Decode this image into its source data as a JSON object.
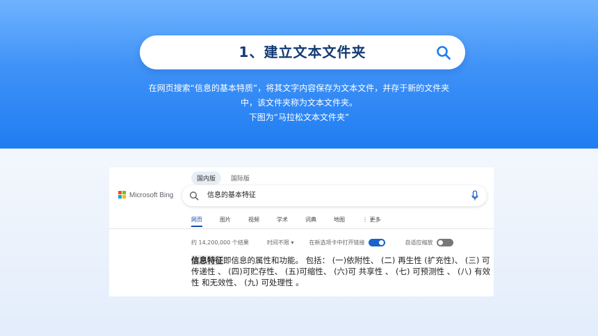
{
  "slide": {
    "title": "1、建立文本文件夹",
    "description": [
      "在网页搜索“信息的基本特质”，将其文字内容保存为文本文件，并存于新的文件夹",
      "中，该文件夹称为文本文件夹。",
      "下图为“马拉松文本文件夹”"
    ],
    "colors": {
      "band_top": "#6fb3ff",
      "band_bottom": "#1f7df2",
      "title_text": "#123a74"
    }
  },
  "bing": {
    "region_tabs": [
      "国内版",
      "国际版"
    ],
    "logo_text": "Microsoft Bing",
    "search_value": "信息的基本特征",
    "nav_tabs": [
      "网页",
      "图片",
      "视频",
      "学术",
      "词典",
      "地图",
      "更多"
    ],
    "result_count": "约 14,200,000 个结果",
    "time_filter": "时间不限",
    "open_in_new_tab": "在新选项卡中打开链接",
    "adaptive_zoom": "自适应缩放",
    "result_highlight": "信息特征",
    "result_text": "即信息的属性和功能。 包括： (一)依附性、 (二) 再生性 (扩充性)、 (三) 可传递性 、 (四)可贮存性、 (五)可缩性、 (六)可 共享性 、 (七) 可预测性 、 (八) 有效性 和无效性、 (九) 可处理性 。",
    "toggles": {
      "open_in_new_tab": true,
      "adaptive_zoom": false
    }
  }
}
